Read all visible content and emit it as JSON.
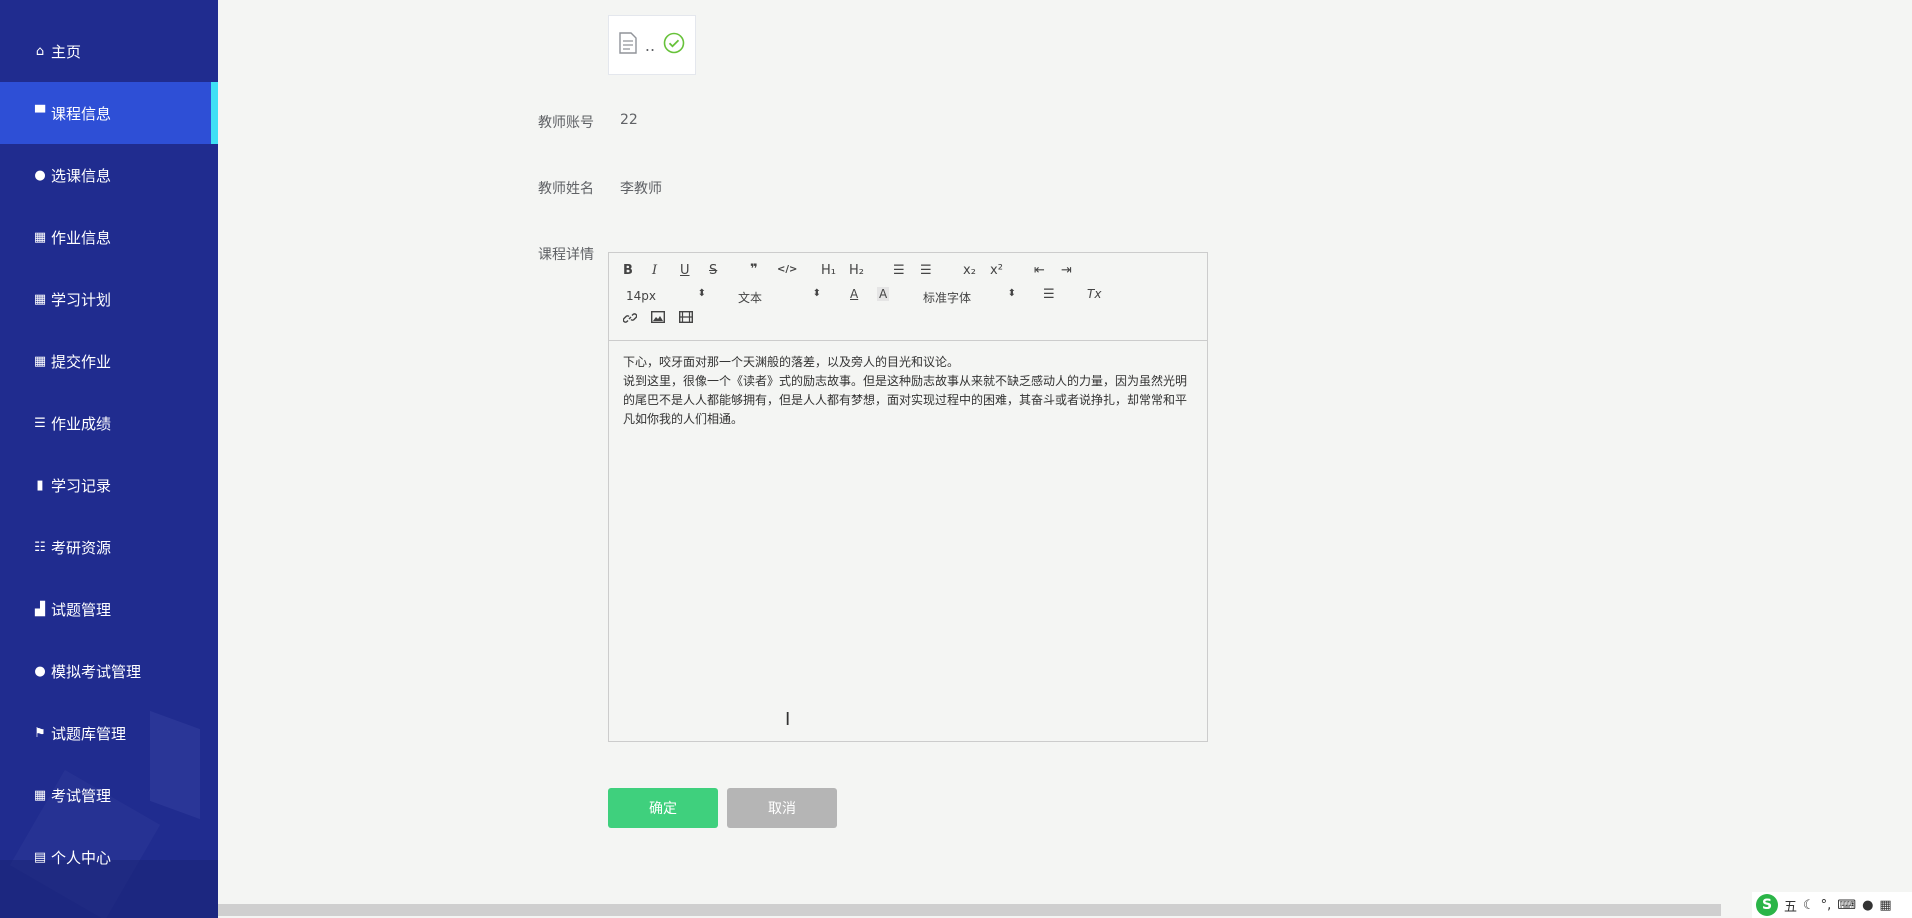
{
  "sidebar": {
    "items": [
      {
        "label": "主页",
        "icon": "home-icon",
        "glyph": "⌂"
      },
      {
        "label": "课程信息",
        "icon": "monitor-icon",
        "glyph": "▀",
        "active": true
      },
      {
        "label": "选课信息",
        "icon": "user-icon",
        "glyph": "●"
      },
      {
        "label": "作业信息",
        "icon": "grid-icon",
        "glyph": "▦"
      },
      {
        "label": "学习计划",
        "icon": "grid-icon",
        "glyph": "▦"
      },
      {
        "label": "提交作业",
        "icon": "grid-icon",
        "glyph": "▦"
      },
      {
        "label": "作业成绩",
        "icon": "list-icon",
        "glyph": "☰"
      },
      {
        "label": "学习记录",
        "icon": "book-icon",
        "glyph": "▮"
      },
      {
        "label": "考研资源",
        "icon": "sliders-icon",
        "glyph": "☷"
      },
      {
        "label": "试题管理",
        "icon": "bar-chart-icon",
        "glyph": "▟"
      },
      {
        "label": "模拟考试管理",
        "icon": "bulb-icon",
        "glyph": "●"
      },
      {
        "label": "试题库管理",
        "icon": "flag-icon",
        "glyph": "⚑"
      },
      {
        "label": "考试管理",
        "icon": "grid-icon",
        "glyph": "▦"
      },
      {
        "label": "个人中心",
        "icon": "profile-icon",
        "glyph": "▤"
      }
    ]
  },
  "file": {
    "name": "..",
    "status_icon": "check-circle-icon"
  },
  "form": {
    "teacher_account_label": "教师账号",
    "teacher_account_value": "22",
    "teacher_name_label": "教师姓名",
    "teacher_name_value": "李教师",
    "course_detail_label": "课程详情"
  },
  "editor": {
    "toolbar": {
      "bold": "B",
      "italic": "I",
      "underline": "U",
      "strike": "S",
      "quote": "❞",
      "code": "</>",
      "h1": "H₁",
      "h2": "H₂",
      "ol": "☰",
      "ul": "☰",
      "sub": "x₂",
      "sup": "x²",
      "outdent": "⇤",
      "indent": "⇥",
      "size": "14px",
      "header": "文本",
      "font": "标准字体",
      "color": "A",
      "background": "A",
      "align": "☰",
      "clean": "Tx",
      "link": "🔗",
      "image": "▣",
      "video": "▤"
    },
    "content": [
      "下心，咬牙面对那一个天渊般的落差，以及旁人的目光和议论。",
      "说到这里，很像一个《读者》式的励志故事。但是这种励志故事从来就不缺乏感动人的力量，因为虽然光明的尾巴不是人人都能够拥有，但是人人都有梦想，面对实现过程中的困难，其奋斗或者说挣扎，却常常和平凡如你我的人们相通。"
    ]
  },
  "buttons": {
    "confirm": "确定",
    "cancel": "取消"
  },
  "tray": {
    "ime": "五",
    "logo": "S"
  }
}
